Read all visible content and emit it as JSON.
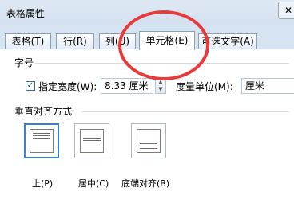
{
  "window": {
    "title": "表格属性",
    "close_glyph": "✕"
  },
  "tabs": [
    {
      "label": "表格(T)",
      "active": false
    },
    {
      "label": "行(R)",
      "active": false
    },
    {
      "label": "列(U)",
      "active": false
    },
    {
      "label": "单元格(E)",
      "active": true
    },
    {
      "label": "可选文字(A)",
      "active": false
    }
  ],
  "size_section": {
    "label": "字号",
    "specify_width_checkbox": {
      "checked": true,
      "label": "指定宽度(W):"
    },
    "width_value": "8.33 厘米",
    "measure_label": "度量单位(M):",
    "measure_value": "厘米"
  },
  "vertical_align": {
    "label": "垂直对齐方式",
    "options": [
      {
        "label": "上(P)",
        "selected": true
      },
      {
        "label": "居中(C)",
        "selected": false
      },
      {
        "label": "底端对齐(B)",
        "selected": false
      }
    ]
  },
  "annotation": {
    "color": "#e53b3b",
    "shape": "red-ellipse"
  }
}
